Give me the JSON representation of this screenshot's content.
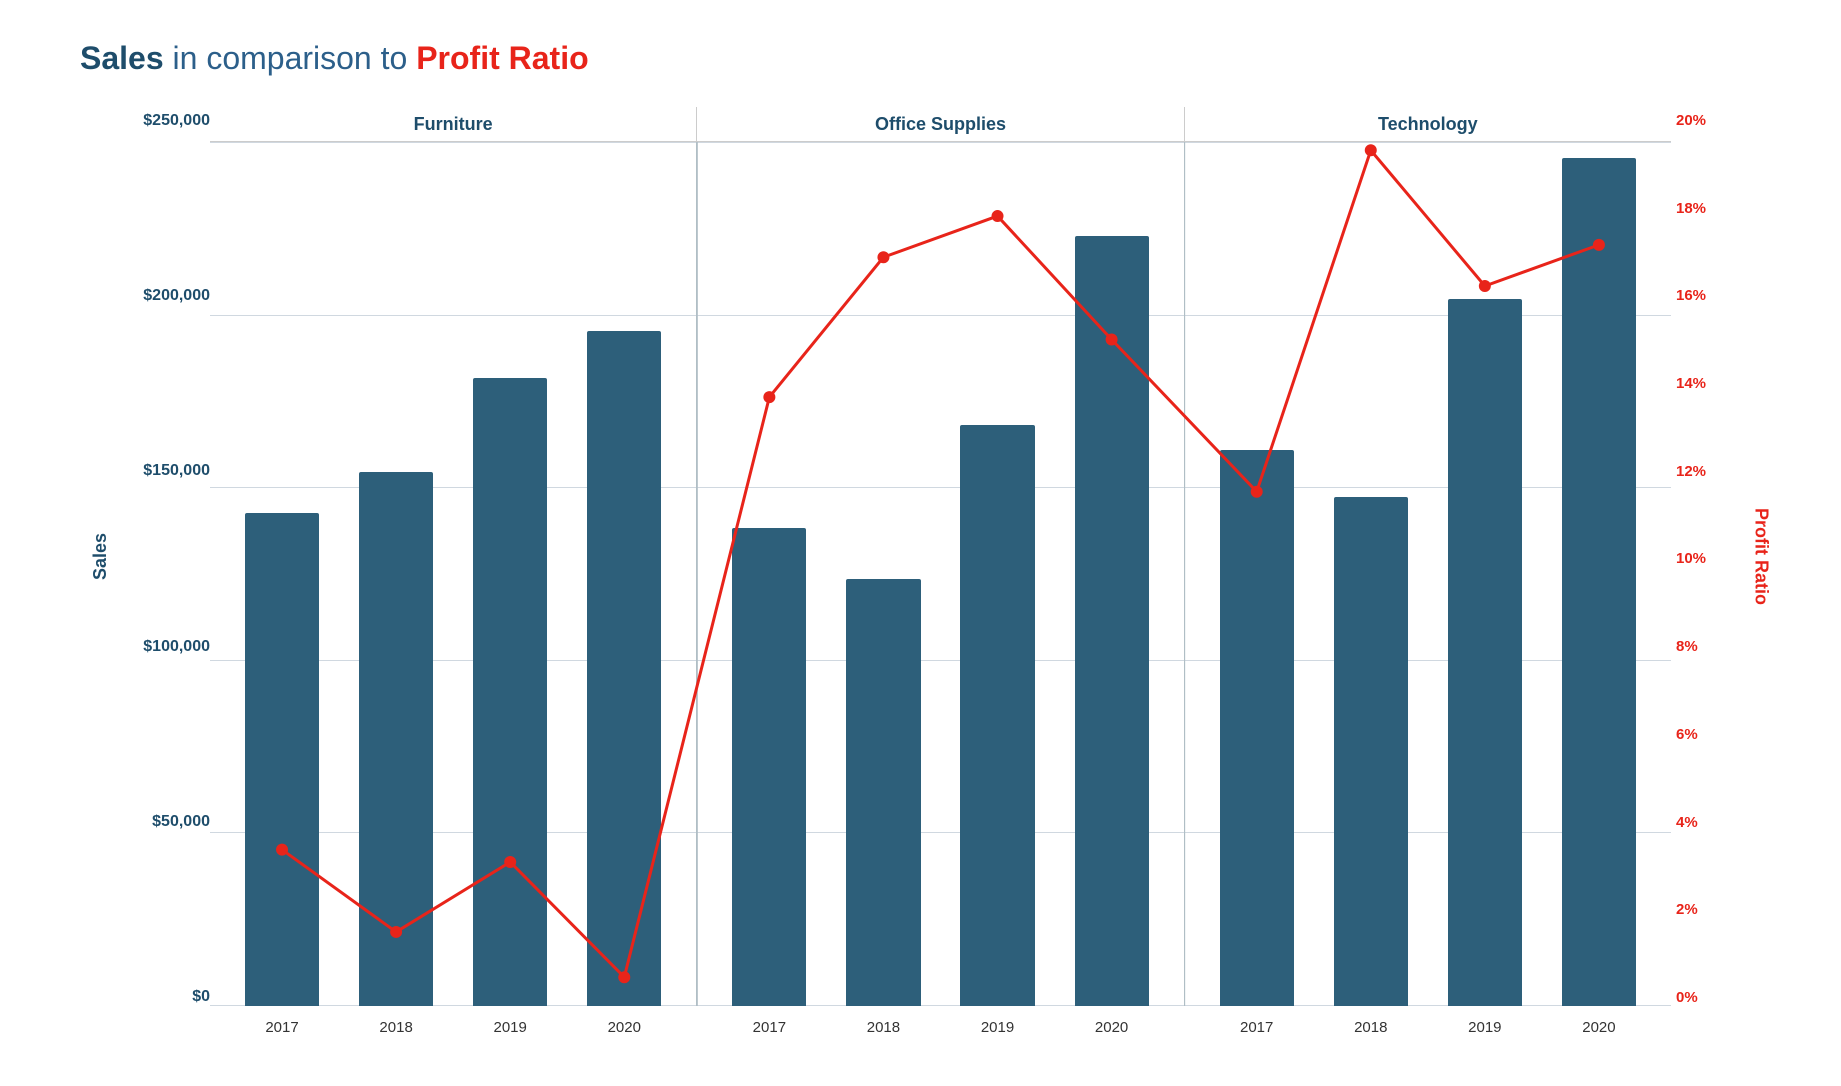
{
  "title": {
    "prefix": "Sales",
    "middle": " in comparison to ",
    "suffix": "Profit Ratio"
  },
  "yAxis": {
    "left": {
      "label": "Sales",
      "ticks": [
        "$0",
        "$50,000",
        "$100,000",
        "$150,000",
        "$200,000",
        "$250,000"
      ]
    },
    "right": {
      "label": "Profit Ratio",
      "ticks": [
        "0%",
        "2%",
        "4%",
        "6%",
        "8%",
        "10%",
        "12%",
        "14%",
        "16%",
        "18%",
        "20%"
      ]
    }
  },
  "categories": [
    {
      "name": "Furniture",
      "bars": [
        {
          "year": "2017",
          "value": 157000,
          "profitRatio": 0.038
        },
        {
          "year": "2018",
          "value": 170000,
          "profitRatio": 0.018
        },
        {
          "year": "2019",
          "value": 200000,
          "profitRatio": 0.035
        },
        {
          "year": "2020",
          "value": 215000,
          "profitRatio": 0.007
        }
      ]
    },
    {
      "name": "Office Supplies",
      "bars": [
        {
          "year": "2017",
          "value": 152000,
          "profitRatio": 0.148
        },
        {
          "year": "2018",
          "value": 136000,
          "profitRatio": 0.182
        },
        {
          "year": "2019",
          "value": 185000,
          "profitRatio": 0.192
        },
        {
          "year": "2020",
          "value": 245000,
          "profitRatio": 0.162
        }
      ]
    },
    {
      "name": "Technology",
      "bars": [
        {
          "year": "2017",
          "value": 177000,
          "profitRatio": 0.125
        },
        {
          "year": "2018",
          "value": 162000,
          "profitRatio": 0.208
        },
        {
          "year": "2019",
          "value": 225000,
          "profitRatio": 0.175
        },
        {
          "year": "2020",
          "value": 270000,
          "profitRatio": 0.185
        }
      ]
    }
  ],
  "chart": {
    "maxSales": 275000,
    "maxProfit": 0.21
  }
}
